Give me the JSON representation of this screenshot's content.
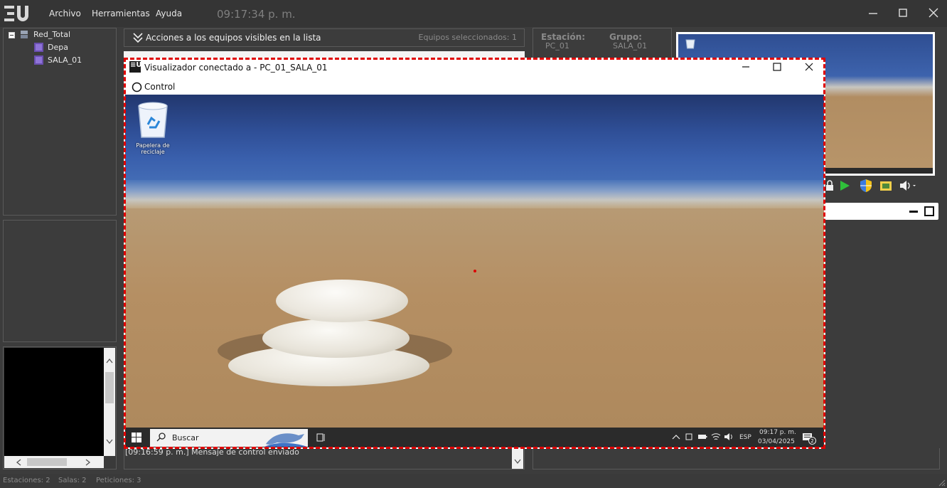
{
  "app": {
    "menu": [
      "Archivo",
      "Herramientas",
      "Ayuda"
    ],
    "clock": "09:17:34 p. m."
  },
  "tree": {
    "root": "Red_Total",
    "children": [
      "Depa",
      "SALA_01"
    ]
  },
  "actions": {
    "label": "Acciones a los equipos visibles en la lista",
    "selected": "Equipos seleccionados: 1"
  },
  "station": {
    "station_label": "Estación:",
    "group_label": "Grupo:",
    "station_value": "PC_01",
    "group_value": "SALA_01"
  },
  "viewer": {
    "title": "Visualizador conectado a - PC_01_SALA_01",
    "control_label": "Control",
    "desktop_icon_label_1": "Papelera de",
    "desktop_icon_label_2": "reciclaje",
    "search_placeholder": "Buscar",
    "lang": "ESP",
    "time": "09:17 p. m.",
    "date": "03/04/2025",
    "notif_count": "2"
  },
  "log": {
    "line": "[09:16:59 p. m.] Mensaje de control enviado"
  },
  "status": {
    "stations": "Estaciones: 2",
    "rooms": "Salas: 2",
    "requests": "Peticiones: 3"
  },
  "colors": {
    "accent": "#e00000",
    "background": "#3c3c3c",
    "sand": "#b8956a",
    "sea": "#3a5aa0"
  }
}
